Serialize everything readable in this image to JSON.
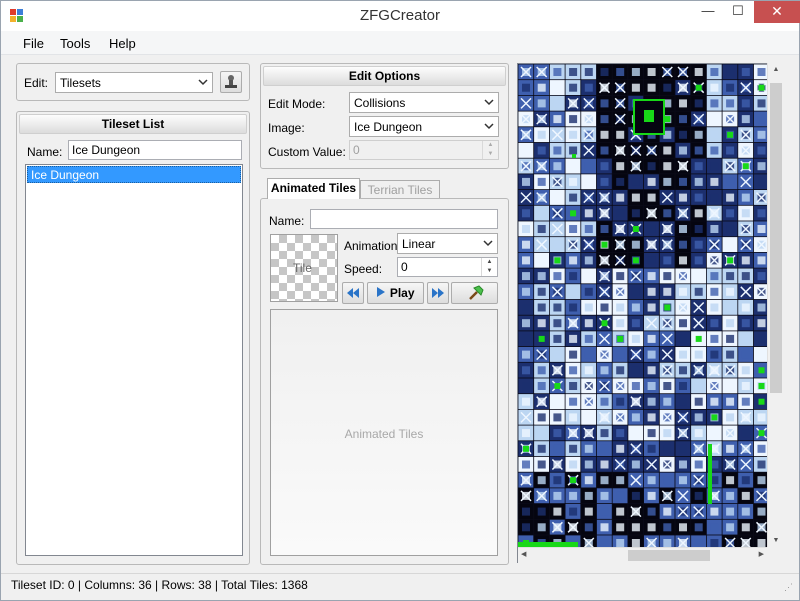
{
  "window": {
    "title": "ZFGCreator",
    "close_symbol": "✕",
    "min_symbol": "—",
    "max_symbol": "☐"
  },
  "menu": [
    "File",
    "Tools",
    "Help"
  ],
  "edit": {
    "label": "Edit:",
    "value": "Tilesets"
  },
  "tileset_list": {
    "header": "Tileset List",
    "name_label": "Name:",
    "name_value": "Ice Dungeon",
    "items": [
      "Ice Dungeon"
    ]
  },
  "edit_options": {
    "header": "Edit Options",
    "edit_mode_label": "Edit Mode:",
    "edit_mode_value": "Collisions",
    "image_label": "Image:",
    "image_value": "Ice Dungeon",
    "custom_value_label": "Custom Value:",
    "custom_value": "0"
  },
  "tabs": [
    "Animated Tiles",
    "Terrian Tiles"
  ],
  "animated": {
    "name_label": "Name:",
    "name_value": "",
    "tile_preview_label": "Tile",
    "animation_label": "Animation:",
    "animation_value": "Linear",
    "speed_label": "Speed:",
    "speed_value": "0",
    "play_label": "Play",
    "list_placeholder": "Animated Tiles"
  },
  "status": {
    "text": "Tileset ID: 0 | Columns: 36 | Rows: 38 | Total Tiles: 1368"
  },
  "colors": {
    "tile_dark": "#1c2f6e",
    "tile_mid": "#3f5fae",
    "tile_light": "#bcd6f2",
    "tile_white": "#eef6ff",
    "tile_black": "#050510",
    "tile_green": "#18d818",
    "selection": "#3399ff"
  }
}
